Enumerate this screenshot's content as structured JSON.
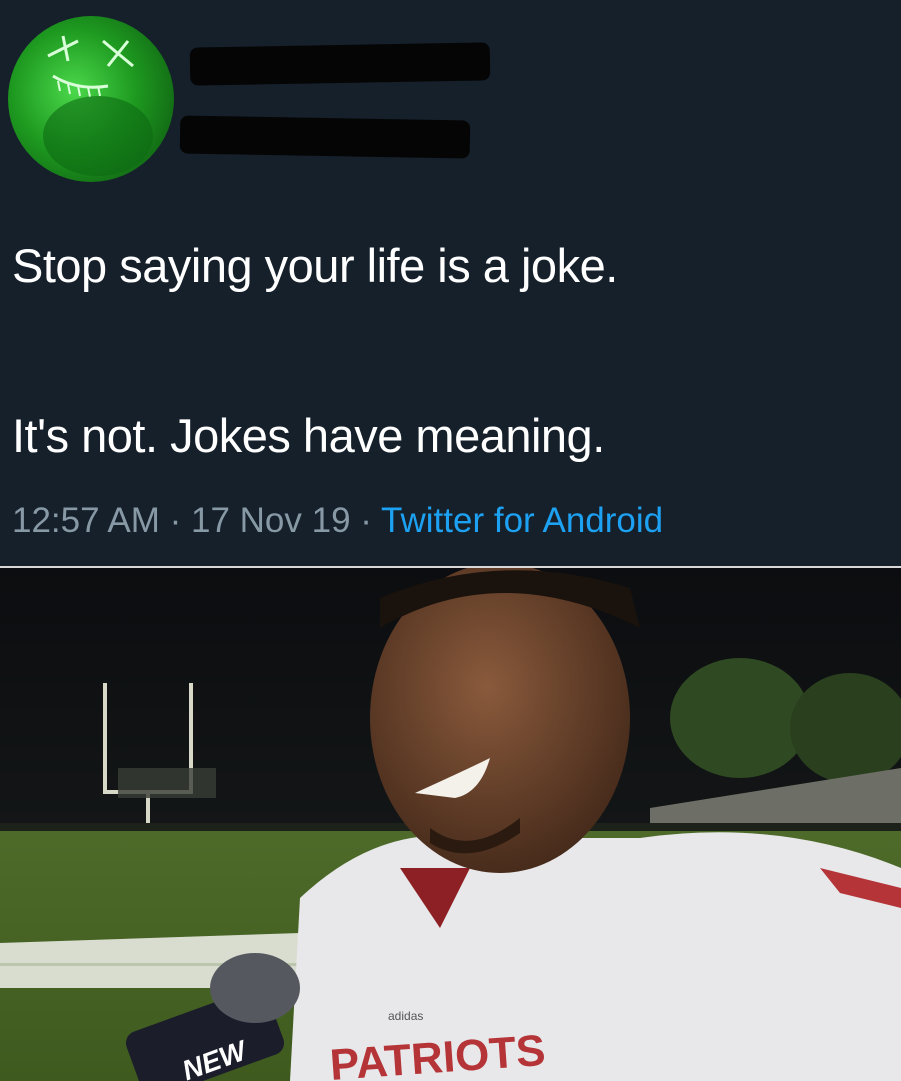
{
  "tweet": {
    "line1": "Stop saying your life is a joke.",
    "line2": "It's not. Jokes have meaning.",
    "time": "12:57 AM",
    "date": "17 Nov 19",
    "source": "Twitter for Android",
    "separator": " · "
  },
  "photo": {
    "mic_flag_text": "NEW",
    "jersey_text": "PATRIOTS",
    "brand_text": "adidas"
  },
  "colors": {
    "background": "#15202b",
    "text": "#ffffff",
    "meta": "#8899a6",
    "link": "#1da1f2"
  }
}
